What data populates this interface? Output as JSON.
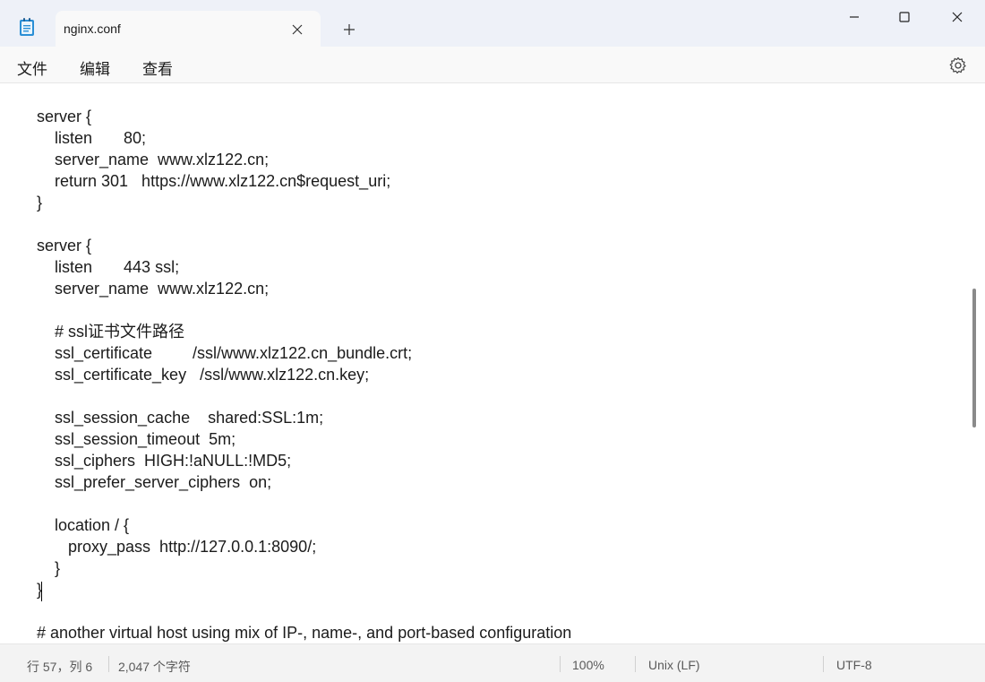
{
  "window": {
    "tab_title": "nginx.conf",
    "icons": {
      "app": "notepad-icon",
      "close_tab": "close-icon",
      "new_tab": "plus-icon",
      "minimize": "minimize-icon",
      "maximize": "maximize-icon",
      "close_window": "close-icon"
    }
  },
  "menu": {
    "file": "文件",
    "edit": "编辑",
    "view": "查看",
    "settings_icon": "gear-icon"
  },
  "editor": {
    "lines": [
      "server {",
      "    listen       80;",
      "    server_name  www.xlz122.cn;",
      "    return 301   https://www.xlz122.cn$request_uri;",
      "}",
      "",
      "server {",
      "    listen       443 ssl;",
      "    server_name  www.xlz122.cn;",
      "",
      "    # ssl证书文件路径",
      "    ssl_certificate         /ssl/www.xlz122.cn_bundle.crt;",
      "    ssl_certificate_key   /ssl/www.xlz122.cn.key;",
      "",
      "    ssl_session_cache    shared:SSL:1m;",
      "    ssl_session_timeout  5m;",
      "    ssl_ciphers  HIGH:!aNULL:!MD5;",
      "    ssl_prefer_server_ciphers  on;",
      "",
      "    location / {",
      "       proxy_pass  http://127.0.0.1:8090/;",
      "    }",
      "}",
      "",
      "# another virtual host using mix of IP-, name-, and port-based configuration"
    ]
  },
  "status": {
    "position": "行 57，列 6",
    "char_count": "2,047 个字符",
    "zoom": "100%",
    "line_ending": "Unix (LF)",
    "encoding": "UTF-8"
  }
}
